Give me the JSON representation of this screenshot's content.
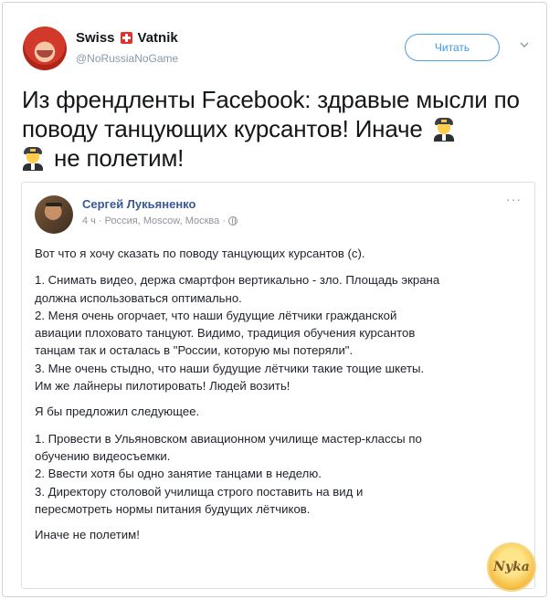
{
  "tweet": {
    "author_name_left": "Swiss",
    "author_name_right": "Vatnik",
    "handle": "@NoRussiaNoGame",
    "follow_label": "Читать",
    "text_part1": "Из френдленты Facebook: здравые мысли по поводу танцующих курсантов! Иначе",
    "text_part2": "не полетим!",
    "emoji": "pilot"
  },
  "fb_post": {
    "author": "Сергей Лукьяненко",
    "meta": "4 ч · Россия, Moscow, Москва ·",
    "paragraphs": [
      "Вот что я хочу сказать по поводу танцующих курсантов (с).",
      "1. Снимать видео, держа смартфон вертикально - зло. Площадь экрана\nдолжна использоваться оптимально.\n2. Меня очень огорчает, что наши будущие лётчики гражданской\nавиации плоховато танцуют. Видимо, традиция обучения курсантов\nтанцам так и осталась в \"России, которую мы потеряли\".\n3. Мне очень стыдно, что наши будущие лётчики такие тощие шкеты.\nИм же лайнеры пилотировать! Людей возить!",
      "Я бы предложил следующее.",
      "1. Провести в Ульяновском авиационном училище мастер-классы по\nобучению видеосъемки.\n2. Ввести хотя бы одно занятие танцами в неделю.\n3. Директору столовой училища строго поставить на вид и\nпересмотреть нормы питания будущих лётчиков.",
      "Иначе не полетим!"
    ]
  },
  "watermark": {
    "text": "Nyka"
  },
  "colors": {
    "follow_blue": "#3d9ae5",
    "fb_link": "#385898",
    "swiss_red": "#e4302a"
  }
}
